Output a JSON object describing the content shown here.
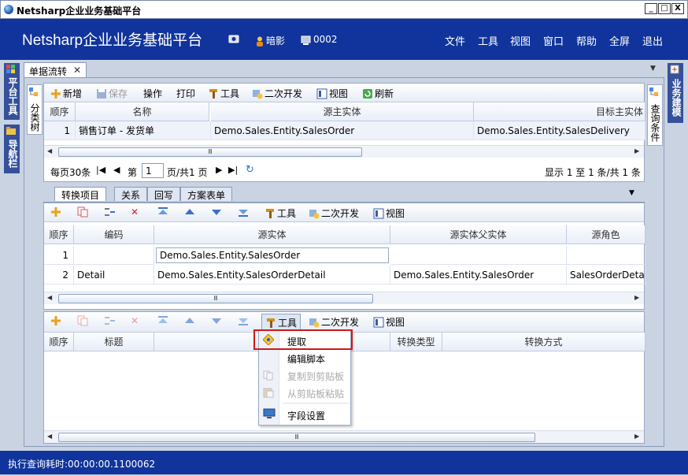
{
  "window": {
    "title": "Netsharp企业业务基础平台",
    "btn_min": "_",
    "btn_max": "□",
    "btn_close": "X"
  },
  "header": {
    "app_title": "Netsharp企业业务基础平台",
    "user": "暗影",
    "code": "0002",
    "menu": [
      "文件",
      "工具",
      "视图",
      "窗口",
      "帮助",
      "全屏",
      "退出"
    ]
  },
  "left_sidebar": {
    "tabs": [
      "平台工具",
      "导航栏"
    ]
  },
  "right_sidebar": {
    "tabs": [
      "业务建模"
    ]
  },
  "doc_tab": {
    "label": "单据流转",
    "close": "✕"
  },
  "panel_labels": {
    "category_tree": "分类树",
    "query_conditions": "查询条件"
  },
  "toolbar1": {
    "new": "新增",
    "save": "保存",
    "operate": "操作",
    "print": "打印",
    "tools": "工具",
    "dev": "二次开发",
    "view": "视图",
    "refresh": "刷新"
  },
  "grid1": {
    "headers": [
      "顺序",
      "名称",
      "源主实体",
      "目标主实体"
    ],
    "rows": [
      [
        "1",
        "销售订单 - 发货单",
        "Demo.Sales.Entity.SalesOrder",
        "Demo.Sales.Entity.SalesDelivery"
      ]
    ]
  },
  "pager": {
    "per_page": "每页30条",
    "page_label": "第",
    "page_value": "1",
    "total_pages": "页/共1 页",
    "summary": "显示 1 至 1 条/共 1 条"
  },
  "subtabs": [
    "转换项目",
    "关系",
    "回写",
    "方案表单"
  ],
  "toolbar2": {
    "tools": "工具",
    "dev": "二次开发",
    "view": "视图"
  },
  "grid2": {
    "headers": [
      "顺序",
      "编码",
      "源实体",
      "源实体父实体",
      "源角色"
    ],
    "rows": [
      [
        "1",
        "",
        "Demo.Sales.Entity.SalesOrder",
        "",
        ""
      ],
      [
        "2",
        "Detail",
        "Demo.Sales.Entity.SalesOrderDetail",
        "Demo.Sales.Entity.SalesOrder",
        "SalesOrderDetails"
      ]
    ]
  },
  "toolbar3": {
    "tools": "工具",
    "dev": "二次开发",
    "view": "视图"
  },
  "grid3": {
    "headers": [
      "顺序",
      "标题",
      "源属性",
      "转换类型",
      "转换方式"
    ]
  },
  "context_menu": {
    "items": [
      {
        "label": "提取",
        "enabled": true
      },
      {
        "label": "编辑脚本",
        "enabled": true
      },
      {
        "label": "复制到剪贴板",
        "enabled": false
      },
      {
        "label": "从剪贴板粘贴",
        "enabled": false
      },
      {
        "label": "字段设置",
        "enabled": true
      }
    ]
  },
  "scroll_thumb": "Ⅲ",
  "status": {
    "text": "执行查询耗时:00:00:00.1100062"
  },
  "colors": {
    "header_bg": "#10349b",
    "highlight": "#d01818"
  }
}
